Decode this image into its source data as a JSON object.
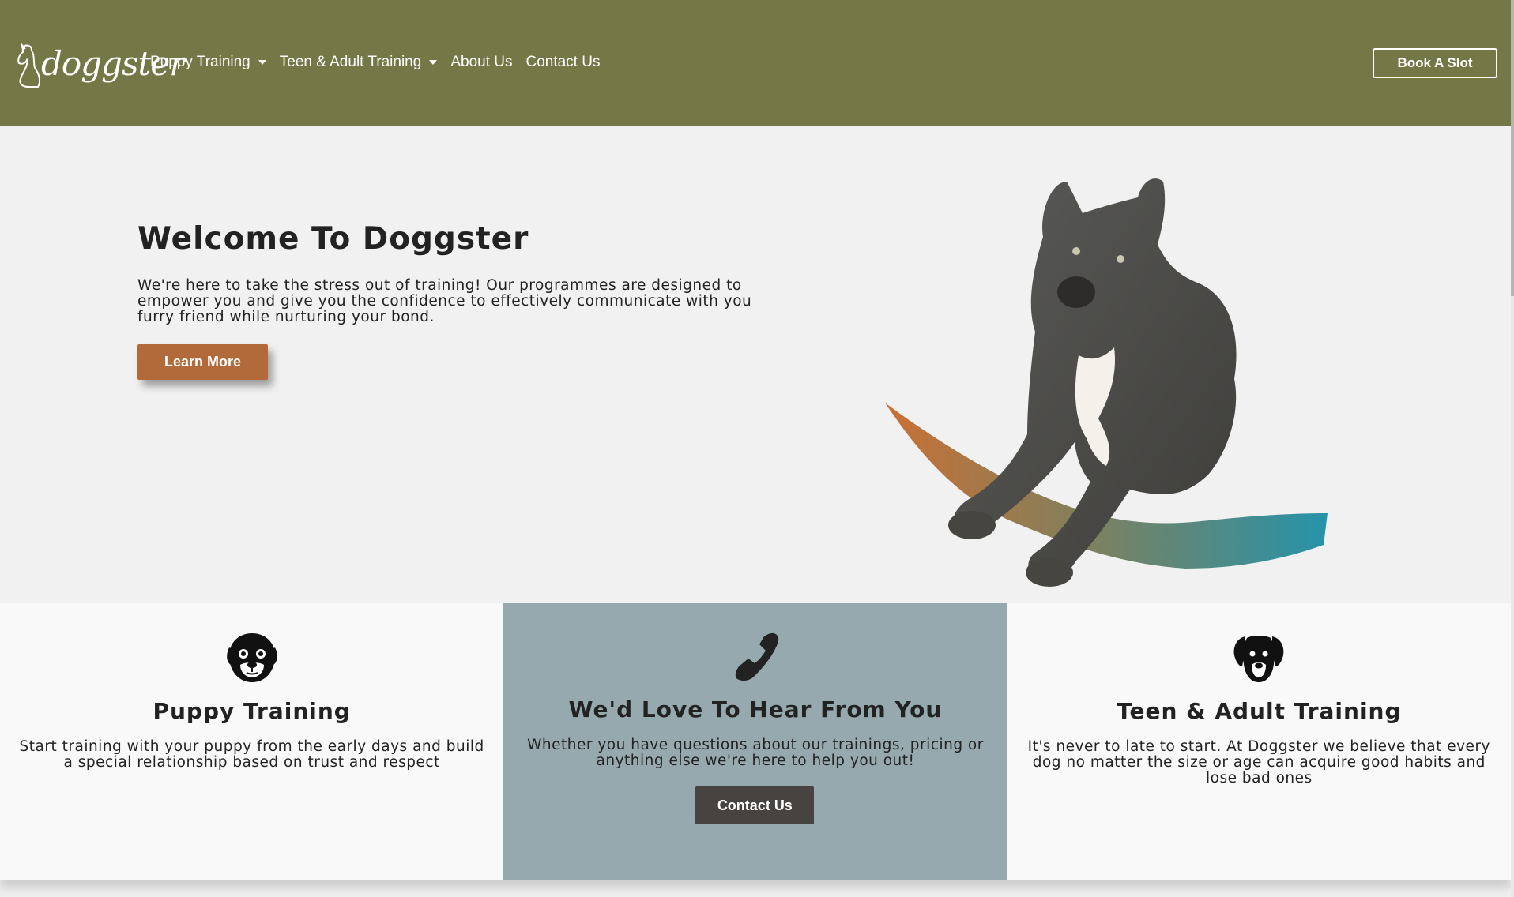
{
  "nav": {
    "brand": "doggster",
    "links": [
      {
        "label": "Puppy Training",
        "dropdown": true
      },
      {
        "label": "Teen & Adult Training",
        "dropdown": true
      },
      {
        "label": "About Us",
        "dropdown": false
      },
      {
        "label": "Contact Us",
        "dropdown": false
      }
    ],
    "cta": "Book A Slot"
  },
  "hero": {
    "title": "Welcome To Doggster",
    "text": "We're here to take the stress out of training! Our programmes are designed to empower you and give you the confidence to effectively communicate with you furry friend while nurturing your bond.",
    "button": "Learn More"
  },
  "cards": [
    {
      "icon": "pug-face-icon",
      "title": "Puppy Training",
      "text": "Start training with your puppy from the early days and build a special relationship based on trust and respect"
    },
    {
      "icon": "phone-icon",
      "title": "We'd Love To Hear From You",
      "text": "Whether you have questions about our trainings, pricing or anything else we're here to help you out!",
      "button": "Contact Us"
    },
    {
      "icon": "dog-face-icon",
      "title": "Teen & Adult Training",
      "text": "It's never to late to start. At Doggster we believe that every dog no matter the size or age can acquire good habits and lose bad ones"
    }
  ],
  "colors": {
    "navbar": "#747846",
    "accent_button": "#b26a3b",
    "contact_card": "#96a9af",
    "contact_button": "#464340"
  }
}
